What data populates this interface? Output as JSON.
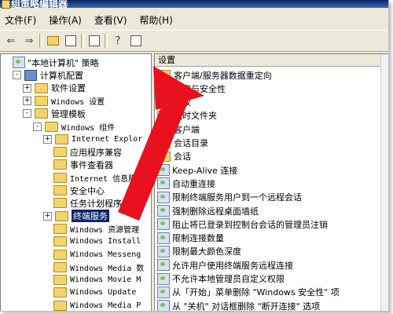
{
  "window": {
    "title": "组策略编辑器"
  },
  "menu": [
    "文件(F)",
    "操作(A)",
    "查看(V)",
    "帮助(H)"
  ],
  "left_tree": [
    {
      "label": "\"本地计算机\" 策略",
      "indent": 0,
      "icon": "policy-icon",
      "exp": ""
    },
    {
      "label": "计算机配置",
      "indent": 1,
      "icon": "computer-icon",
      "exp": "-"
    },
    {
      "label": "软件设置",
      "indent": 2,
      "icon": "folder-icon",
      "exp": "+"
    },
    {
      "label": "Windows 设置",
      "indent": 2,
      "icon": "folder-icon",
      "exp": "+"
    },
    {
      "label": "管理模板",
      "indent": 2,
      "icon": "folder-icon",
      "exp": "-"
    },
    {
      "label": "Windows 组件",
      "indent": 3,
      "icon": "folder-icon",
      "exp": "-"
    },
    {
      "label": "Internet Explor",
      "indent": 4,
      "icon": "folder-icon",
      "exp": "+"
    },
    {
      "label": "应用程序兼容",
      "indent": 4,
      "icon": "folder-icon",
      "exp": ""
    },
    {
      "label": "事件查看器",
      "indent": 4,
      "icon": "folder-icon",
      "exp": ""
    },
    {
      "label": "Internet 信息服",
      "indent": 4,
      "icon": "folder-icon",
      "exp": ""
    },
    {
      "label": "安全中心",
      "indent": 4,
      "icon": "folder-icon",
      "exp": ""
    },
    {
      "label": "任务计划程序",
      "indent": 4,
      "icon": "folder-icon",
      "exp": ""
    },
    {
      "label": "终端服务",
      "indent": 4,
      "icon": "folder-icon",
      "exp": "+",
      "selected": true
    },
    {
      "label": "Windows 资源管理",
      "indent": 4,
      "icon": "folder-icon",
      "exp": ""
    },
    {
      "label": "Windows Install",
      "indent": 4,
      "icon": "folder-icon",
      "exp": ""
    },
    {
      "label": "Windows Messeng",
      "indent": 4,
      "icon": "folder-icon",
      "exp": ""
    },
    {
      "label": "Windows Media 数",
      "indent": 4,
      "icon": "folder-icon",
      "exp": ""
    },
    {
      "label": "Windows Movie M",
      "indent": 4,
      "icon": "folder-icon",
      "exp": ""
    },
    {
      "label": "Windows Update",
      "indent": 4,
      "icon": "folder-icon",
      "exp": ""
    },
    {
      "label": "Windows Media P",
      "indent": 4,
      "icon": "folder-icon",
      "exp": ""
    }
  ],
  "right_header": "设置",
  "right_items": [
    {
      "label": "客户端/服务器数据重定向",
      "type": "folder"
    },
    {
      "label": "加密与安全性",
      "type": "folder"
    },
    {
      "label": "授权",
      "type": "folder"
    },
    {
      "label": "临时文件夹",
      "type": "folder"
    },
    {
      "label": "客户端",
      "type": "folder"
    },
    {
      "label": "会话目录",
      "type": "folder"
    },
    {
      "label": "会话",
      "type": "folder"
    },
    {
      "label": "Keep-Alive 连接",
      "type": "policy"
    },
    {
      "label": "自动重连接",
      "type": "policy"
    },
    {
      "label": "限制终端服务用户到一个远程会话",
      "type": "policy"
    },
    {
      "label": "强制删除远程桌面墙纸",
      "type": "policy"
    },
    {
      "label": "阻止将已登录到控制台会话的管理员注销",
      "type": "policy"
    },
    {
      "label": "限制连接数量",
      "type": "policy"
    },
    {
      "label": "限制最大颜色深度",
      "type": "policy"
    },
    {
      "label": "允许用户使用终端服务远程连接",
      "type": "policy"
    },
    {
      "label": "不允许本地管理员自定义权限",
      "type": "policy"
    },
    {
      "label": "从「开始」菜单删除 \"Windows 安全性\" 项",
      "type": "policy"
    },
    {
      "label": "从 \"关机\" 对话框删除 \"断开连接\" 选项",
      "type": "policy"
    }
  ],
  "colors": {
    "arrow": "#e8111d",
    "selection": "#0a246a"
  }
}
